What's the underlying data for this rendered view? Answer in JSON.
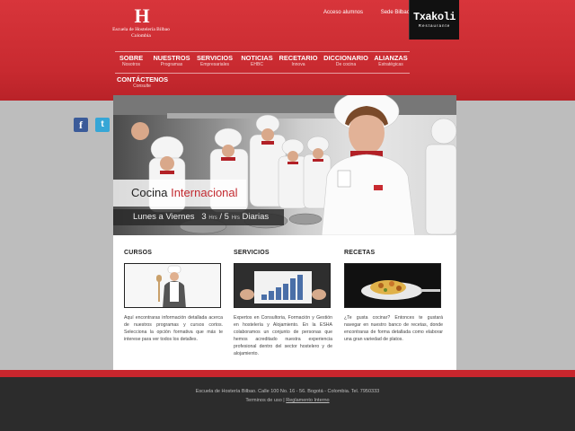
{
  "header": {
    "logo": {
      "mark": "H",
      "line1": "Escuela de Hostelería Bilbao",
      "line2": "Colombia"
    },
    "top_links": [
      "Acceso alumnos",
      "Sede Bilbao"
    ],
    "partner": {
      "name": "Txakoli",
      "tagline": "Restaurante"
    }
  },
  "nav": [
    {
      "label": "SOBRE",
      "sub": "Nosotros"
    },
    {
      "label": "NUESTROS",
      "sub": "Programas"
    },
    {
      "label": "SERVICIOS",
      "sub": "Empresariales"
    },
    {
      "label": "NOTICIAS",
      "sub": "EHBC"
    },
    {
      "label": "RECETARIO",
      "sub": "Innova"
    },
    {
      "label": "DICCIONARIO",
      "sub": "De cocina"
    },
    {
      "label": "ALIANZAS",
      "sub": "Estratégicas"
    },
    {
      "label": "CONTÁCTENOS",
      "sub": "Consulte"
    }
  ],
  "social": {
    "facebook": "f",
    "twitter": "t"
  },
  "hero": {
    "title_part1": "Cocina",
    "title_part2": "Internacional",
    "schedule_days": "Lunes a Viernes",
    "schedule_hours_a": "3",
    "schedule_unit_a": "Hrs",
    "schedule_sep": "/",
    "schedule_hours_b": "5",
    "schedule_unit_b": "Hrs",
    "schedule_tail": "Diarias"
  },
  "columns": [
    {
      "title": "CURSOS",
      "text": "Aquí encontraras información detallada acerca de nuestros programas y cursos cortos. Selecciona la opción formativa que más te interese para ver todos los detalles."
    },
    {
      "title": "SERVICIOS",
      "text": "Expertos en Consultoria, Formación y Gestión en hostelería y Alojamiento. En la ESHA colaboramos un conjunto de personas que hemos acreditado nuestra experiencia profesional dentro del sector hostelero y de alojamiento."
    },
    {
      "title": "RECETAS",
      "text": "¿Te gusta cocinar? Entonces te gustará navegar en nuestro banco de recetas, donde encontraras de forma detallada como elaborar una gran variedad de platos."
    }
  ],
  "footer": {
    "address": "Escuela de Hostería Bilbao. Calle 100 No. 16 - 56. Bogotá - Colombia. Tel. 7950333",
    "terms": "Terminos de uso",
    "separator": "|",
    "internal_rules": "Reglamento Interno"
  },
  "colors": {
    "brand_red": "#c82a30",
    "footer_dark": "#2c2c2c",
    "page_grey": "#bdbdbd"
  }
}
